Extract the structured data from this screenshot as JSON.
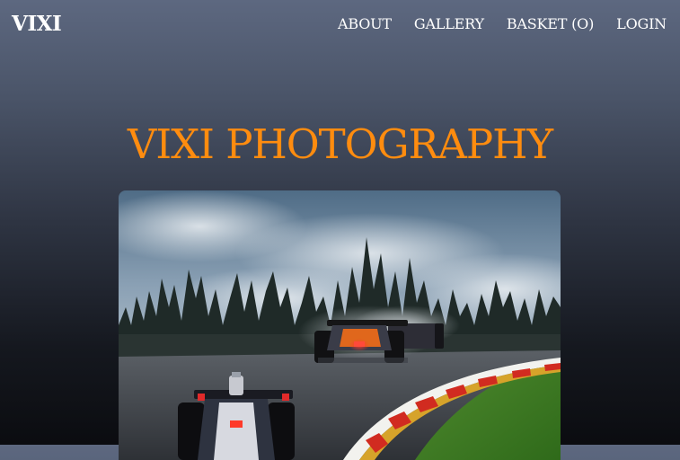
{
  "nav": {
    "logo": "VIXI",
    "links": [
      {
        "label": "ABOUT"
      },
      {
        "label": "GALLERY"
      },
      {
        "label": "BASKET (O)"
      },
      {
        "label": "LOGIN"
      }
    ]
  },
  "hero": {
    "title": "VIXI PHOTOGRAPHY"
  },
  "colors": {
    "accent": "#ff8c0f",
    "nav_text": "#ffffff"
  }
}
